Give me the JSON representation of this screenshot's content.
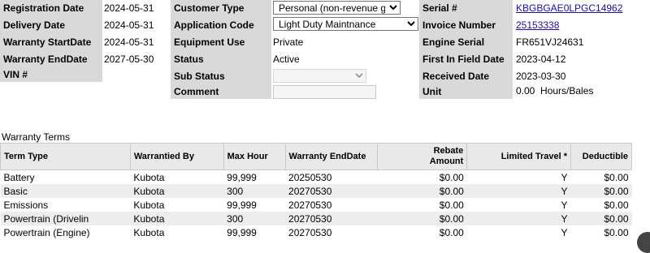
{
  "left_fields": [
    {
      "label": "Registration Date",
      "value": "2024-05-31"
    },
    {
      "label": "Delivery Date",
      "value": "2024-05-31"
    },
    {
      "label": "Warranty StartDate",
      "value": "2024-05-31"
    },
    {
      "label": "Warranty EndDate",
      "value": "2027-05-30"
    },
    {
      "label": "VIN #",
      "value": ""
    }
  ],
  "middle_fields": {
    "customer_type": {
      "label": "Customer Type",
      "value": "Personal (non-revenue gen)"
    },
    "application_code": {
      "label": "Application Code",
      "value": "Light Duty Maintnance"
    },
    "equipment_use": {
      "label": "Equipment Use",
      "value": "Private"
    },
    "status": {
      "label": "Status",
      "value": "Active"
    },
    "sub_status": {
      "label": "Sub Status",
      "value": ""
    },
    "comment": {
      "label": "Comment",
      "value": ""
    }
  },
  "right_fields": {
    "serial": {
      "label": "Serial #",
      "value": "KBGBGAE0LPGC14962"
    },
    "invoice": {
      "label": "Invoice Number",
      "value": "25153338"
    },
    "engine_serial": {
      "label": "Engine Serial Number",
      "value": "FR651VJ24631"
    },
    "first_in_field": {
      "label": "First In Field Date",
      "value": "2023-04-12"
    },
    "received": {
      "label": "Received Date",
      "value": "2023-03-30"
    },
    "unit": {
      "label": "Unit",
      "value": "0.00  Hours/Bales"
    }
  },
  "warranty_terms": {
    "title": "Warranty Terms",
    "columns": [
      "Term Type",
      "Warrantied By",
      "Max Hour",
      "Warranty EndDate",
      "Rebate Amount",
      "Limited Travel *",
      "Deductible"
    ],
    "rows": [
      [
        "Battery",
        "Kubota",
        "99,999",
        "20250530",
        "$0.00",
        "Y",
        "$0.00"
      ],
      [
        "Basic",
        "Kubota",
        "300",
        "20270530",
        "$0.00",
        "Y",
        "$0.00"
      ],
      [
        "Emissions",
        "Kubota",
        "99,999",
        "20270530",
        "$0.00",
        "Y",
        "$0.00"
      ],
      [
        "Powertrain (Drivelin",
        "Kubota",
        "300",
        "20270530",
        "$0.00",
        "Y",
        "$0.00"
      ],
      [
        "Powertrain (Engine)",
        "Kubota",
        "99,999",
        "20270530",
        "$0.00",
        "Y",
        "$0.00"
      ]
    ]
  }
}
